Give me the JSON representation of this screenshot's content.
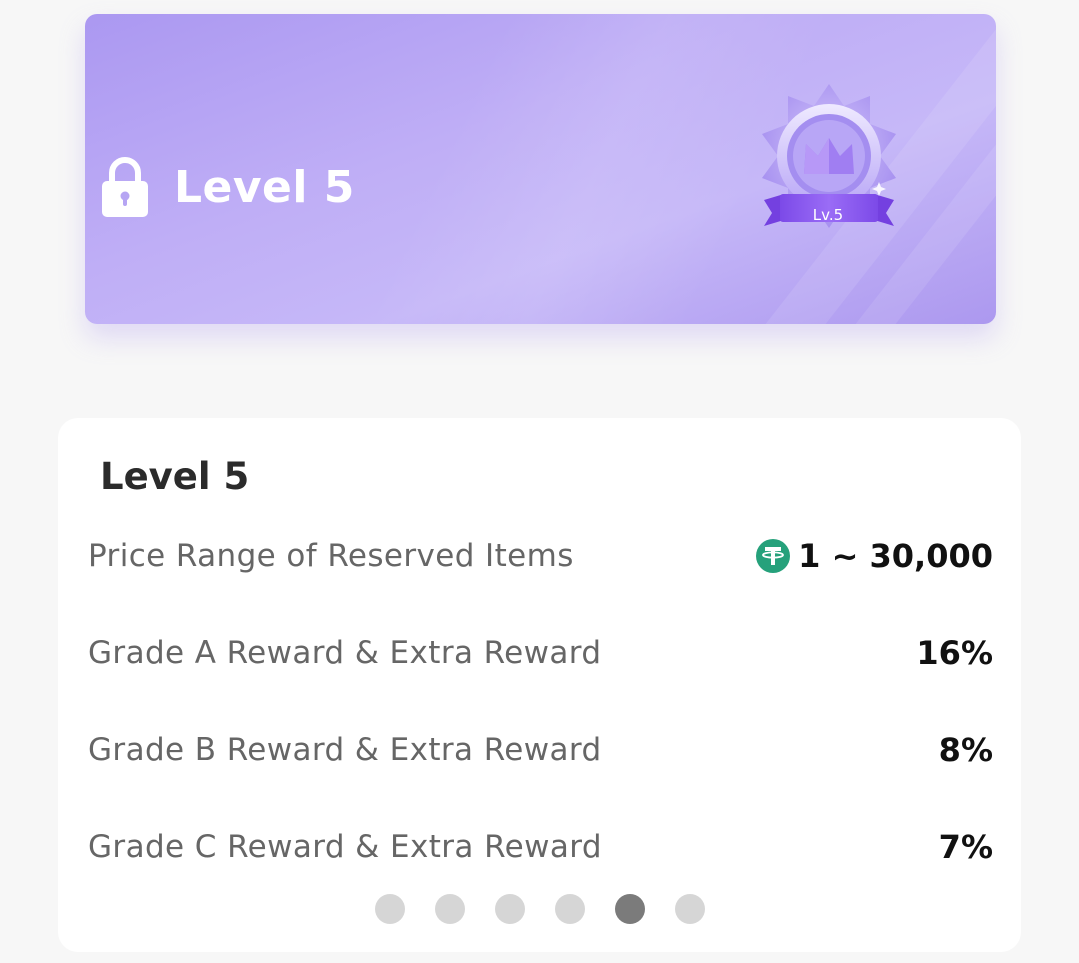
{
  "level_card": {
    "title": "Level 5",
    "badge_label": "Lv.5",
    "locked": true,
    "icons": [
      "lock-icon",
      "level-badge-icon"
    ]
  },
  "details": {
    "title": "Level 5",
    "rows": [
      {
        "label": "Price Range of Reserved Items",
        "value": "1 ~ 30,000",
        "icon": "tether-usdt-icon"
      },
      {
        "label": "Grade A Reward & Extra Reward",
        "value": "16%"
      },
      {
        "label": "Grade B Reward & Extra Reward",
        "value": "8%"
      },
      {
        "label": "Grade C Reward & Extra Reward",
        "value": "7%"
      }
    ]
  },
  "pagination": {
    "total": 6,
    "active_index": 4
  },
  "colors": {
    "card_gradient_start": "#ab98f1",
    "card_gradient_end": "#c6b8f8",
    "badge_purple": "#8a5cf0",
    "tether_green": "#26a17b",
    "dot_inactive": "#d6d6d6",
    "dot_active": "#7b7b7b",
    "label_text": "#666666",
    "value_text": "#111111"
  }
}
